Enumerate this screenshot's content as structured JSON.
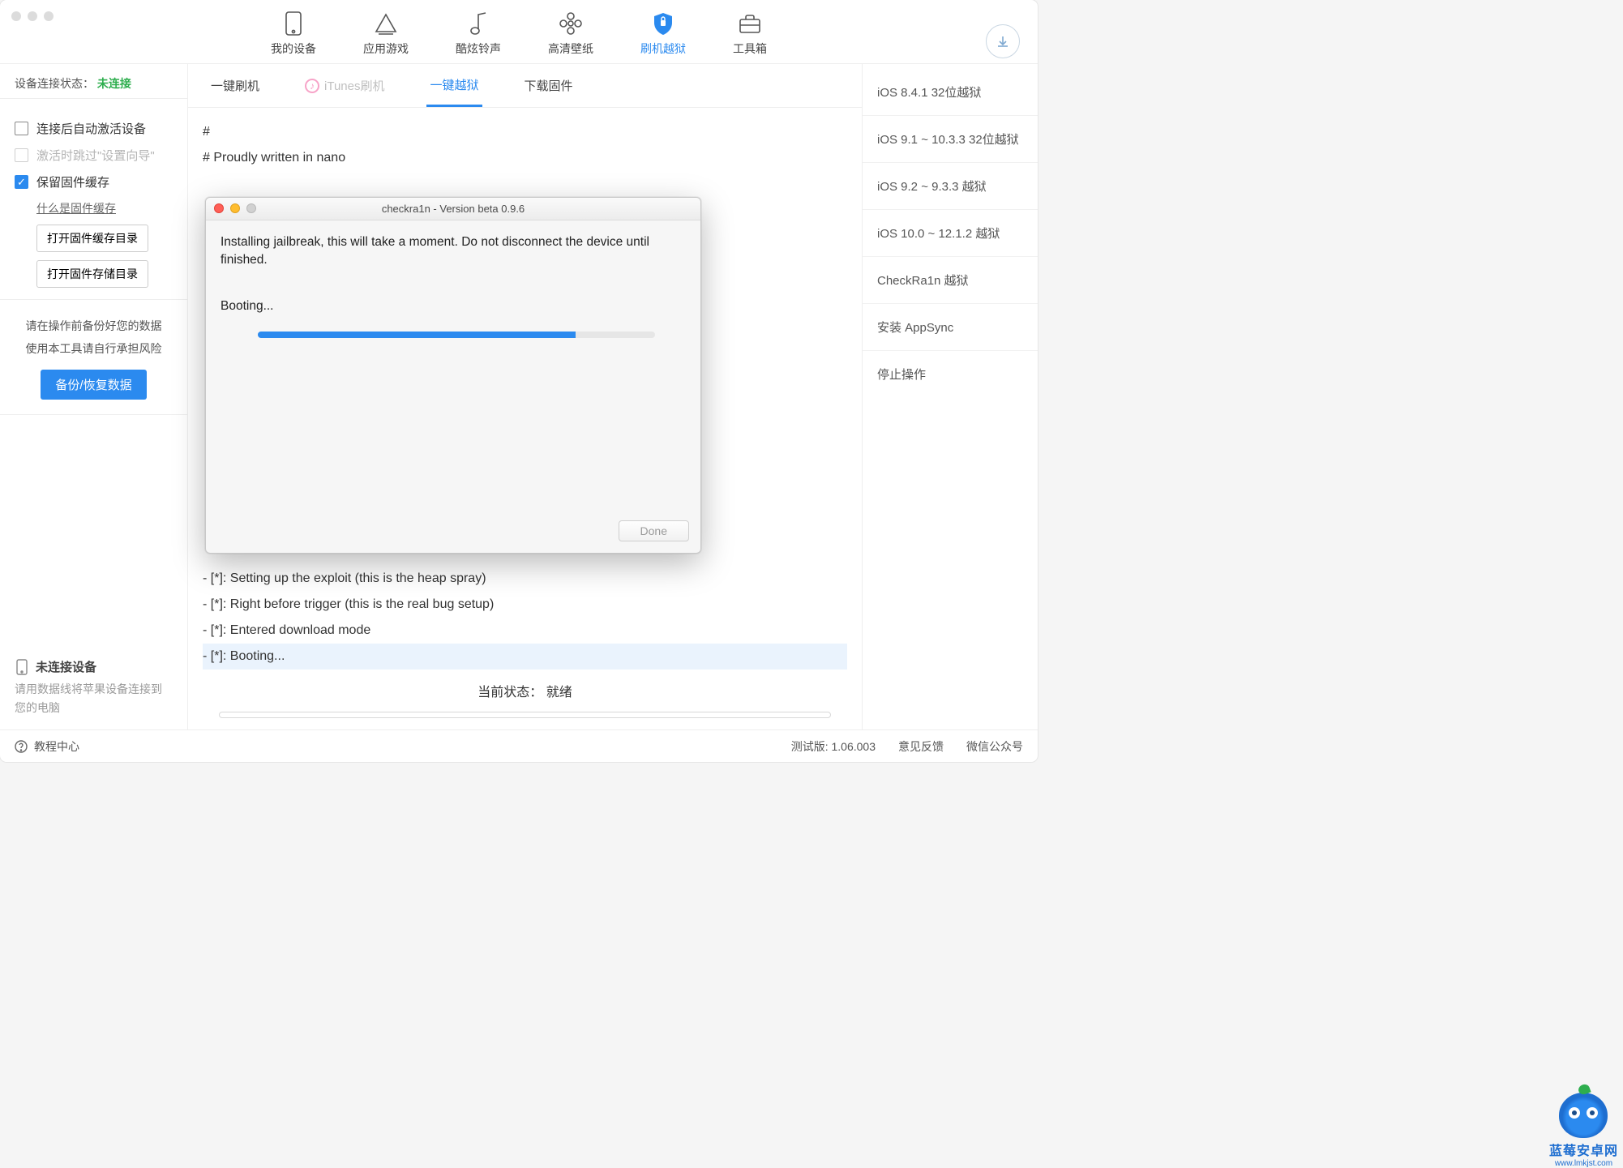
{
  "topnav": {
    "items": [
      {
        "label": "我的设备"
      },
      {
        "label": "应用游戏"
      },
      {
        "label": "酷炫铃声"
      },
      {
        "label": "高清壁纸"
      },
      {
        "label": "刷机越狱",
        "active": true
      },
      {
        "label": "工具箱"
      }
    ]
  },
  "sidebar": {
    "conn_label": "设备连接状态：",
    "conn_value": "未连接",
    "opts": {
      "auto_activate": "连接后自动激活设备",
      "skip_setup": "激活时跳过\"设置向导\"",
      "keep_cache": "保留固件缓存",
      "what_is_cache": "什么是固件缓存",
      "open_cache_dir": "打开固件缓存目录",
      "open_store_dir": "打开固件存储目录"
    },
    "notice_l1": "请在操作前备份好您的数据",
    "notice_l2": "使用本工具请自行承担风险",
    "backup_btn": "备份/恢复数据",
    "footer_title": "未连接设备",
    "footer_hint": "请用数据线将苹果设备连接到您的电脑"
  },
  "subtabs": {
    "flash": "一键刷机",
    "itunes": "iTunes刷机",
    "jailbreak": "一键越狱",
    "download": "下载固件"
  },
  "log": {
    "l1": "#",
    "l2": "# Proudly written in nano",
    "bottom": [
      "- [*]: Setting up the exploit (this is the heap spray)",
      "- [*]: Right before trigger (this is the real bug setup)",
      "- [*]: Entered download mode",
      "- [*]: Booting..."
    ]
  },
  "status": {
    "label": "当前状态：",
    "value": "就绪"
  },
  "rightcol": {
    "items": [
      "iOS 8.4.1 32位越狱",
      "iOS 9.1 ~ 10.3.3 32位越狱",
      "iOS 9.2 ~ 9.3.3 越狱",
      "iOS 10.0 ~ 12.1.2 越狱",
      "CheckRa1n 越狱",
      "安装 AppSync",
      "停止操作"
    ]
  },
  "footer": {
    "help_center": "教程中心",
    "version": "测试版: 1.06.003",
    "feedback": "意见反馈",
    "wechat": "微信公众号"
  },
  "modal": {
    "title": "checkra1n - Version beta 0.9.6",
    "message": "Installing jailbreak, this will take a moment. Do not disconnect the device until finished.",
    "status": "Booting...",
    "progress_pct": 80,
    "done": "Done"
  },
  "watermark": {
    "cn": "蓝莓安卓网",
    "url": "www.lmkjst.com"
  }
}
